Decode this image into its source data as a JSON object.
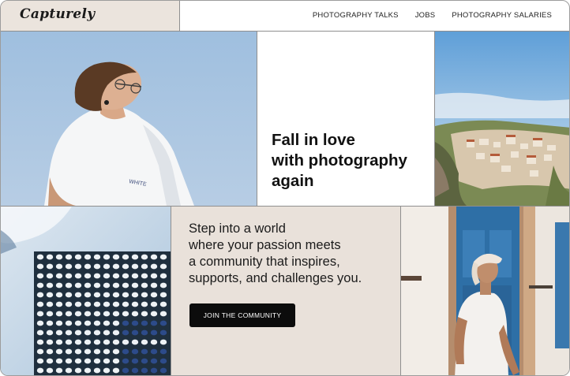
{
  "header": {
    "logo": "Capturely",
    "nav": [
      {
        "label": "PHOTOGRAPHY TALKS"
      },
      {
        "label": "JOBS"
      },
      {
        "label": "PHOTOGRAPHY SALARIES"
      }
    ]
  },
  "hero": {
    "headline_lines": [
      "Fall in love",
      "with photography",
      "again"
    ]
  },
  "community": {
    "tagline_lines": [
      "Step into a world",
      "where your passion meets",
      "a community that inspires,",
      "supports, and challenges you."
    ],
    "cta_label": "JOIN THE COMMUNITY"
  },
  "photos": {
    "shirt_text": "WHITE"
  },
  "colors": {
    "beige": "#e9e1da",
    "sky": "#a9c4de",
    "button": "#0c0c0c"
  }
}
